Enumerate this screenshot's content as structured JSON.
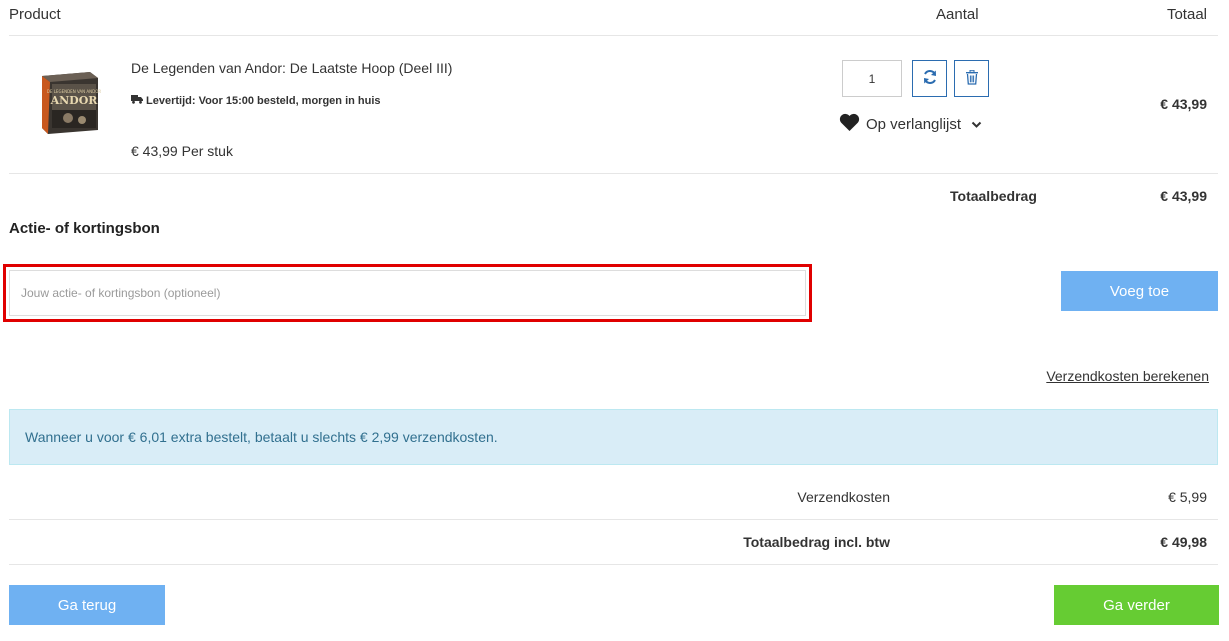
{
  "table_header": {
    "product": "Product",
    "quantity": "Aantal",
    "total": "Totaal"
  },
  "item": {
    "thumbnail_title": "DE LEGENDEN VAN ANDOR",
    "thumbnail_logo": "ANDOR",
    "name": "De Legenden van Andor: De Laatste Hoop (Deel III)",
    "delivery": "Levertijd: Voor 15:00 besteld, morgen in huis",
    "unit_price": "€ 43,99 Per stuk",
    "quantity": "1",
    "wishlist_label": "Op verlanglijst",
    "line_total": "€ 43,99"
  },
  "subtotal": {
    "label": "Totaalbedrag",
    "value": "€ 43,99"
  },
  "coupon": {
    "title": "Actie- of kortingsbon",
    "placeholder": "Jouw actie- of kortingsbon (optioneel)",
    "value": "",
    "add_label": "Voeg toe"
  },
  "shipping_link": "Verzendkosten berekenen",
  "notice": "Wanneer u voor € 6,01 extra bestelt, betaalt u slechts € 2,99 verzendkosten.",
  "summary": {
    "shipping_label": "Verzendkosten",
    "shipping_value": "€ 5,99",
    "total_label": "Totaalbedrag incl. btw",
    "total_value": "€ 49,98"
  },
  "nav": {
    "back_label": "Ga terug",
    "next_label": "Ga verder"
  },
  "colors": {
    "accent_blue": "#6fb1f2",
    "icon_border_blue": "#2b6cb0",
    "continue_green": "#66cc33",
    "highlight_red": "#e00000",
    "notice_bg": "#d9edf7"
  },
  "icons": {
    "refresh": "refresh-icon",
    "delete": "trash-icon",
    "wishlist": "heart-icon",
    "dropdown": "chevron-down-icon",
    "delivery": "truck-icon"
  }
}
